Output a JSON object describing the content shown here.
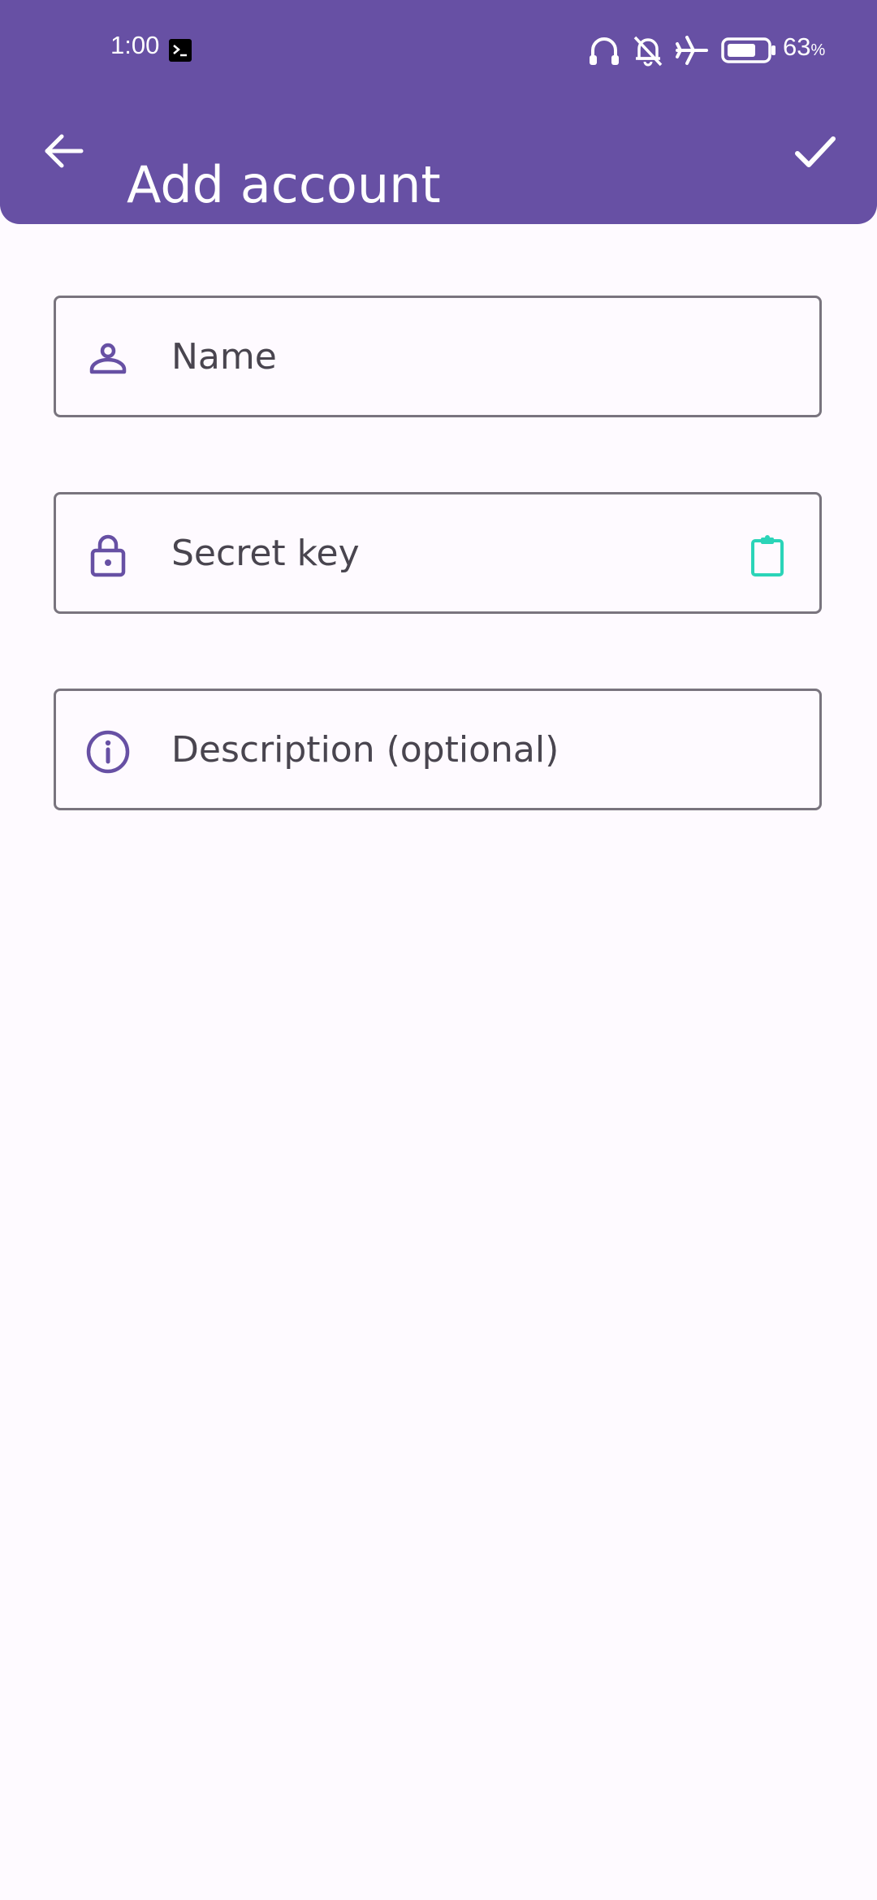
{
  "status_bar": {
    "time": "1:00",
    "battery_percent": "63",
    "battery_unit": "%",
    "icons": [
      "terminal-icon",
      "headphones-icon",
      "notifications-off-icon",
      "airplane-icon",
      "battery-icon"
    ]
  },
  "app_bar": {
    "title": "Add account",
    "back_icon": "arrow-back-icon",
    "confirm_icon": "check-icon"
  },
  "form": {
    "name": {
      "placeholder": "Name",
      "value": "",
      "icon": "person-icon"
    },
    "secret": {
      "placeholder": "Secret key",
      "value": "",
      "icon": "lock-icon",
      "action_icon": "clipboard-paste-icon"
    },
    "description": {
      "placeholder": "Description (optional)",
      "value": "",
      "icon": "info-icon"
    }
  },
  "colors": {
    "primary": "#6750a4",
    "on_primary": "#ffffff",
    "background": "#fefaff",
    "outline": "#79747e",
    "icon_tint": "#6750a4",
    "paste_accent": "#2bd4b8",
    "text": "#49454f"
  }
}
